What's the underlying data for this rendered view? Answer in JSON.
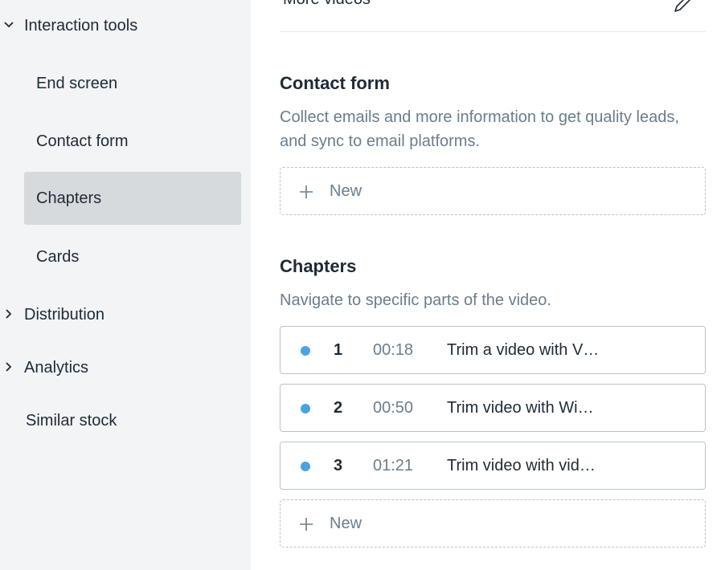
{
  "sidebar": {
    "interaction_tools": {
      "label": "Interaction tools",
      "items": [
        {
          "label": "End screen",
          "active": false
        },
        {
          "label": "Contact form",
          "active": false
        },
        {
          "label": "Chapters",
          "active": true
        },
        {
          "label": "Cards",
          "active": false
        }
      ]
    },
    "distribution_label": "Distribution",
    "analytics_label": "Analytics",
    "similar_stock_label": "Similar stock"
  },
  "main": {
    "more_videos_label": "More videos",
    "contact_form": {
      "heading": "Contact form",
      "description": "Collect emails and more information to get quality leads, and sync to email platforms.",
      "new_label": "New"
    },
    "chapters": {
      "heading": "Chapters",
      "description": "Navigate to specific parts of the video.",
      "items": [
        {
          "number": "1",
          "time": "00:18",
          "title": "Trim a video with V…"
        },
        {
          "number": "2",
          "time": "00:50",
          "title": "Trim video with Wi…"
        },
        {
          "number": "3",
          "time": "01:21",
          "title": "Trim video with vid…"
        }
      ],
      "new_label": "New"
    }
  },
  "colors": {
    "sidebar_bg": "#f2f4f6",
    "active_item_bg": "#d6dadd",
    "chapter_dot": "#4aa3df",
    "muted_text": "#6b7d8c"
  }
}
